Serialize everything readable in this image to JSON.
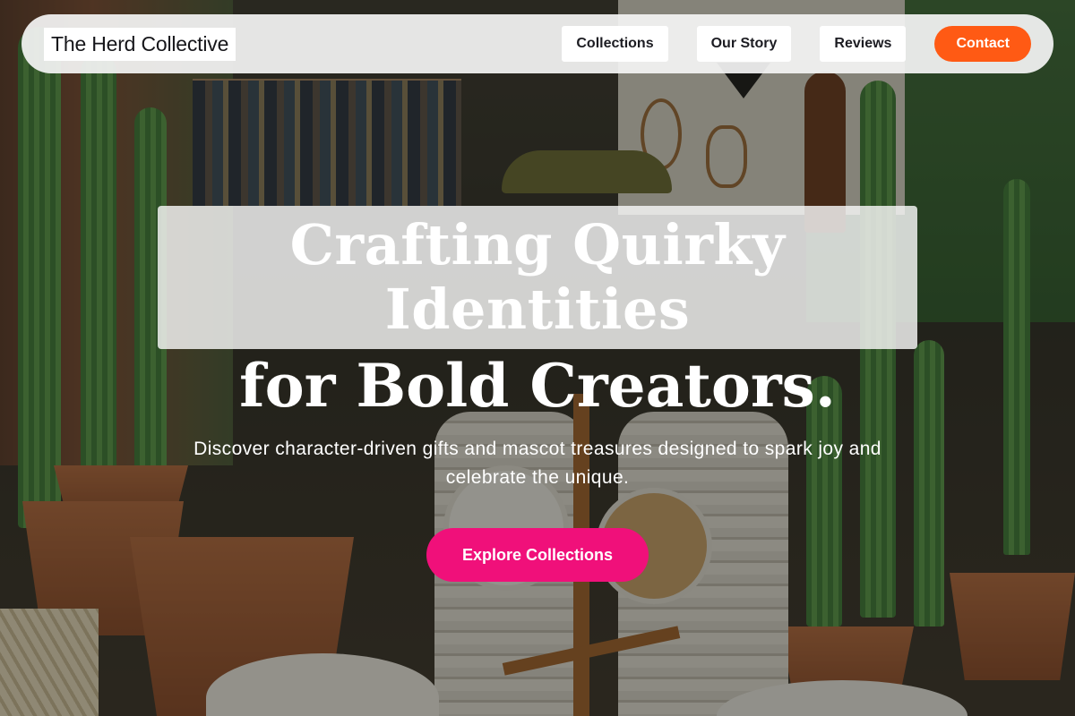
{
  "nav": {
    "brand": "The Herd Collective",
    "links": [
      "Collections",
      "Our Story",
      "Reviews"
    ],
    "cta": "Contact"
  },
  "hero": {
    "title_line1": "Crafting Quirky Identities",
    "title_line2": "for Bold Creators.",
    "subtitle": "Discover character-driven gifts and mascot treasures designed to spark joy and celebrate the unique.",
    "cta": "Explore Collections"
  },
  "colors": {
    "contact_button": "#ff5a14",
    "explore_button": "#f0107a",
    "nav_bar": "#f5f5f5"
  }
}
